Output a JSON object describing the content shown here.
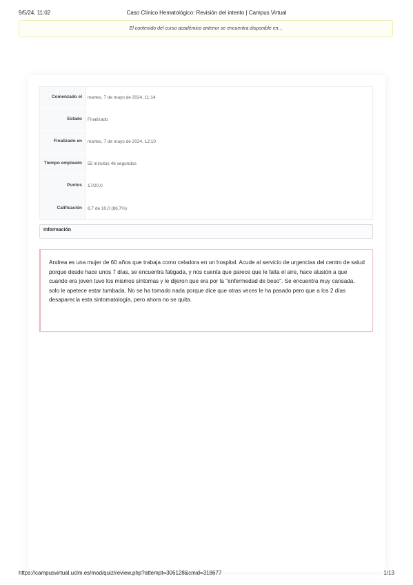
{
  "print_header": {
    "datetime": "9/5/24, 11:02",
    "title": "Caso Clínico Hematológico: Revisión del intento | Campus Virtual"
  },
  "notice": {
    "text": "El contenido del curso académico anterior se encuentra disponible en..."
  },
  "attempt_summary": {
    "rows": [
      {
        "label": "Comenzado el",
        "value": "martes, 7 de mayo de 2024, 11:14"
      },
      {
        "label": "Estado",
        "value": "Finalizado"
      },
      {
        "label": "Finalizado en",
        "value": "martes, 7 de mayo de 2024, 12:10"
      },
      {
        "label": "Tiempo empleado",
        "value": "55 minutos 46 segundos"
      },
      {
        "label": "Puntos",
        "value": "17/20,0"
      },
      {
        "label": "Calificación",
        "value": "8,7 de 10,0 (86,7%)"
      }
    ]
  },
  "info_block": {
    "title": "Información"
  },
  "question": {
    "text": "Andrea es una mujer de 60 años que trabaja como celadora en un hospital. Acude al servicio de urgencias del centro de salud porque desde hace unos 7 días, se encuentra fatigada, y nos cuenta que parece que le falta el aire, hace alusión a que cuando era joven tuvo los mismos síntomas y le dijeron que era por la \"enfermedad de beso\". Se encuentra muy cansada, solo le apetece estar tumbada. No se ha tomado nada porque dice que otras veces le ha pasado pero que a los 2 días desaparecía esta sintomatología, pero ahora no se quita."
  },
  "print_footer": {
    "url": "https://campusvirtual.uclm.es/mod/quiz/review.php?attempt=306128&cmid=318677",
    "page": "1/13"
  }
}
